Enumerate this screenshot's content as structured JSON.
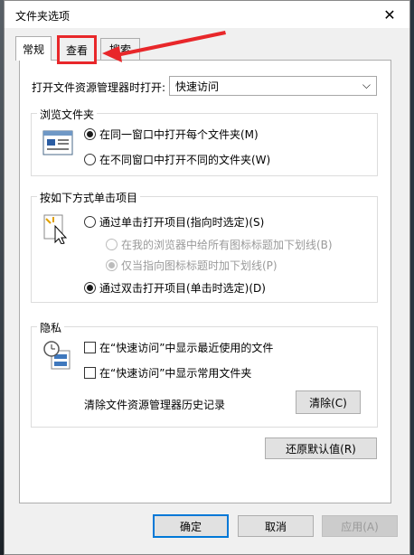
{
  "window": {
    "title": "文件夹选项"
  },
  "tabs": [
    {
      "label": "常规"
    },
    {
      "label": "查看"
    },
    {
      "label": "搜索"
    }
  ],
  "general": {
    "open_explorer_label": "打开文件资源管理器时打开:",
    "open_explorer_value": "快速访问",
    "browse_folders": {
      "title": "浏览文件夹",
      "options": [
        {
          "label": "在同一窗口中打开每个文件夹(M)",
          "selected": true
        },
        {
          "label": "在不同窗口中打开不同的文件夹(W)",
          "selected": false
        }
      ]
    },
    "click_items": {
      "title": "按如下方式单击项目",
      "options": [
        {
          "label": "通过单击打开项目(指向时选定)(S)",
          "selected": false
        },
        {
          "label": "在我的浏览器中给所有图标标题加下划线(B)",
          "selected": false,
          "disabled": true
        },
        {
          "label": "仅当指向图标标题时加下划线(P)",
          "selected": true,
          "disabled": true
        },
        {
          "label": "通过双击打开项目(单击时选定)(D)",
          "selected": true
        }
      ]
    },
    "privacy": {
      "title": "隐私",
      "options": [
        {
          "label": "在“快速访问”中显示最近使用的文件"
        },
        {
          "label": "在“快速访问”中显示常用文件夹"
        }
      ],
      "clear_label": "清除文件资源管理器历史记录",
      "clear_button": "清除(C)"
    },
    "restore_button": "还原默认值(R)"
  },
  "footer": {
    "ok": "确定",
    "cancel": "取消",
    "apply": "应用(A)"
  },
  "colors": {
    "highlight": "#e8272a",
    "accent": "#0078d7"
  }
}
